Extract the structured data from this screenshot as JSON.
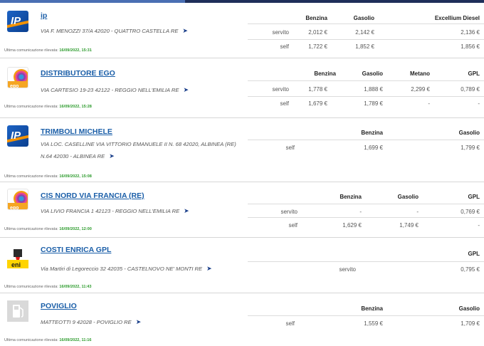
{
  "last_prefix": "Ultima comunicazione rilevata:",
  "stations": [
    {
      "name": "ip",
      "address": "VIA F. MENOZZI 37/A 42020 - QUATTRO CASTELLA RE",
      "last": "16/09/2022, 15:31",
      "logo": "ip-logo-icon",
      "fuels": [
        "Benzina",
        "Gasolio",
        "Excellium Diesel"
      ],
      "rows": [
        {
          "label": "servito",
          "prices": [
            "2,012 €",
            "2,142 €",
            "2,136 €"
          ]
        },
        {
          "label": "self",
          "prices": [
            "1,722 €",
            "1,852 €",
            "1,856 €"
          ]
        }
      ]
    },
    {
      "name": "DISTRIBUTORE EGO",
      "address": "VIA CARTESIO 19-23 42122 - REGGIO NELL'EMILIA RE",
      "last": "16/09/2022, 15:28",
      "logo": "ego-logo-icon",
      "fuels": [
        "Benzina",
        "Gasolio",
        "Metano",
        "GPL"
      ],
      "rows": [
        {
          "label": "servito",
          "prices": [
            "1,778 €",
            "1,888 €",
            "2,299 €",
            "0,789 €"
          ]
        },
        {
          "label": "self",
          "prices": [
            "1,679 €",
            "1,789 €",
            "-",
            "-"
          ]
        }
      ]
    },
    {
      "name": "TRIMBOLI MICHELE",
      "address": "VIA LOC. CASELLINE VIA VITTORIO EMANUELE II N. 68 42020, ALBINEA (RE) N.64 42030 - ALBINEA RE",
      "last": "16/09/2022, 15:08",
      "logo": "ip-logo-icon",
      "fuels": [
        "Benzina",
        "Gasolio"
      ],
      "rows": [
        {
          "label": "self",
          "prices": [
            "1,699 €",
            "1,799 €"
          ]
        }
      ]
    },
    {
      "name": "CIS NORD VIA FRANCIA (RE)",
      "address": "VIA LIVIO FRANCIA 1 42123 - REGGIO NELL'EMILIA RE",
      "last": "16/09/2022, 12:00",
      "logo": "ego-logo-icon",
      "fuels": [
        "Benzina",
        "Gasolio",
        "GPL"
      ],
      "rows": [
        {
          "label": "servito",
          "prices": [
            "-",
            "-",
            "0,769 €"
          ]
        },
        {
          "label": "self",
          "prices": [
            "1,629 €",
            "1,749 €",
            "-"
          ]
        }
      ]
    },
    {
      "name": "COSTI ENRICA GPL",
      "address": "Via Martiri di Legoreccio 32 42035 - CASTELNOVO NE' MONTI RE",
      "last": "16/09/2022, 11:43",
      "logo": "eni-logo-icon",
      "fuels": [
        "GPL"
      ],
      "rows": [
        {
          "label": "servito",
          "prices": [
            "0,795 €"
          ]
        }
      ]
    },
    {
      "name": "POVIGLIO",
      "address": "MATTEOTTI 9 42028 - POVIGLIO RE",
      "last": "16/09/2022, 11:16",
      "logo": "fuel-pump-icon",
      "fuels": [
        "Benzina",
        "Gasolio"
      ],
      "rows": [
        {
          "label": "self",
          "prices": [
            "1,559 €",
            "1,709 €"
          ]
        }
      ]
    }
  ]
}
